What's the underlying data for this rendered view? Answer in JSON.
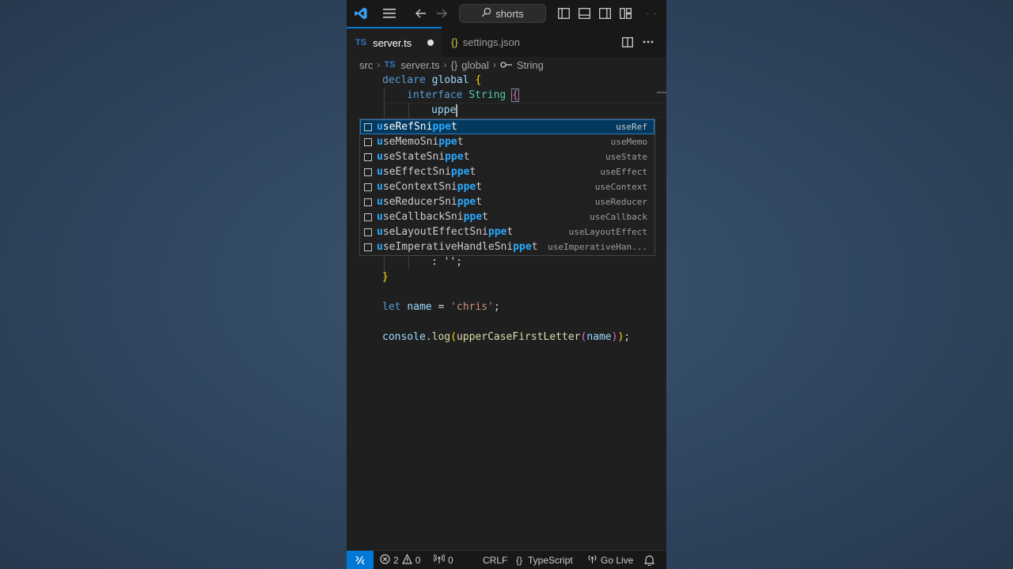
{
  "titlebar": {
    "search_label": "shorts",
    "icons": [
      "vscode-logo",
      "menu-icon",
      "back-arrow-icon",
      "forward-arrow-icon",
      "search-icon",
      "toggle-primary-sidebar-icon",
      "toggle-panel-icon",
      "toggle-secondary-sidebar-icon",
      "customize-layout-icon"
    ]
  },
  "tabs": [
    {
      "label": "server.ts",
      "badge": "TS",
      "dirty": true,
      "active": true
    },
    {
      "label": "settings.json",
      "badge": "{}",
      "active": false
    }
  ],
  "breadcrumb": {
    "folder": "src",
    "file_badge": "TS",
    "file": "server.ts",
    "namespace_icon": "{}",
    "namespace": "global",
    "symbol": "String"
  },
  "code": {
    "l1_kw": "declare",
    "l1_name": "global",
    "l2_kw": "interface",
    "l2_type": "String",
    "l3_typed": "uppe",
    "l4_text": ": '';",
    "l6_let": "let",
    "l6_name": "name",
    "l6_eq": "=",
    "l6_str": "'chris'",
    "l6_semi": ";",
    "l7_console": "console",
    "l7_log": "log",
    "l7_fn": "upperCaseFirstLetter",
    "l7_arg": "name"
  },
  "suggestions": [
    {
      "pre": "u",
      "mid": "seRefSni",
      "hl": "ppe",
      "post": "t",
      "detail": "useRef",
      "selected": true
    },
    {
      "pre": "u",
      "mid": "seMemoSni",
      "hl": "ppe",
      "post": "t",
      "detail": "useMemo"
    },
    {
      "pre": "u",
      "mid": "seStateSni",
      "hl": "ppe",
      "post": "t",
      "detail": "useState"
    },
    {
      "pre": "u",
      "mid": "seEffectSni",
      "hl": "ppe",
      "post": "t",
      "detail": "useEffect"
    },
    {
      "pre": "u",
      "mid": "seContextSni",
      "hl": "ppe",
      "post": "t",
      "detail": "useContext"
    },
    {
      "pre": "u",
      "mid": "seReducerSni",
      "hl": "ppe",
      "post": "t",
      "detail": "useReducer"
    },
    {
      "pre": "u",
      "mid": "seCallbackSni",
      "hl": "ppe",
      "post": "t",
      "detail": "useCallback"
    },
    {
      "pre": "u",
      "mid": "seLayoutEffectSni",
      "hl": "ppe",
      "post": "t",
      "detail": "useLayoutEffect"
    },
    {
      "pre": "u",
      "mid": "seImperativeHandleSni",
      "hl": "ppe",
      "post": "t",
      "detail": "useImperativeHan..."
    }
  ],
  "statusbar": {
    "errors": "2",
    "warnings": "0",
    "ports": "0",
    "eol": "CRLF",
    "language_icon": "{}",
    "language": "TypeScript",
    "golive": "Go Live"
  },
  "colors": {
    "accent": "#0078d4",
    "editor_bg": "#1f1f1f",
    "ts_blue": "#3178c6",
    "highlight": "#2aaaff"
  }
}
